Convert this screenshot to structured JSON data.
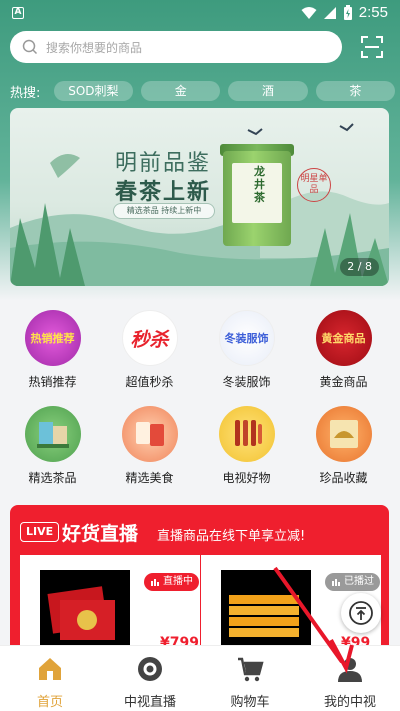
{
  "status_bar": {
    "time": "2:55"
  },
  "search": {
    "placeholder": "搜索你想要的商品"
  },
  "hot_search": {
    "label": "热搜:",
    "chips": [
      "SOD刺梨",
      "金",
      "酒",
      "茶"
    ]
  },
  "banner": {
    "title_line1": "明前品鉴",
    "title_line2": "春茶上新",
    "tagline": "精选茶品 持续上新中",
    "can_text": "龙井茶",
    "seal_text": "明星单品",
    "pager": "2 / 8"
  },
  "categories": [
    {
      "label": "热销推荐",
      "badge": "热销推荐",
      "color": "#c83fd3"
    },
    {
      "label": "超值秒杀",
      "badge": "秒杀",
      "color": "#e8232d"
    },
    {
      "label": "冬装服饰",
      "badge": "冬装服饰",
      "color": "#3d5fd8"
    },
    {
      "label": "黄金商品",
      "badge": "黄金商品",
      "color": "#c6111b"
    },
    {
      "label": "精选茶品",
      "badge": "",
      "color": "#6ab86a"
    },
    {
      "label": "精选美食",
      "badge": "",
      "color": "#f0845a"
    },
    {
      "label": "电视好物",
      "badge": "",
      "color": "#f2c230"
    },
    {
      "label": "珍品收藏",
      "badge": "",
      "color": "#e8742e"
    }
  ],
  "live": {
    "badge": "LIVE",
    "title": "好货直播",
    "subtitle": "直播商品在线下单享立减!",
    "cards": [
      {
        "tag": "直播中",
        "tag_color": "#ef1f2e",
        "price": "¥799"
      },
      {
        "tag": "已播过",
        "tag_color": "#9a9a9a",
        "price": "¥99"
      }
    ]
  },
  "nav": {
    "items": [
      {
        "label": "首页",
        "active": true
      },
      {
        "label": "中视直播",
        "active": false
      },
      {
        "label": "购物车",
        "active": false
      },
      {
        "label": "我的中视",
        "active": false
      }
    ]
  },
  "colors": {
    "accent": "#e0a33a",
    "live_red": "#ef1f2e",
    "header_green": "#3e9b7e"
  }
}
